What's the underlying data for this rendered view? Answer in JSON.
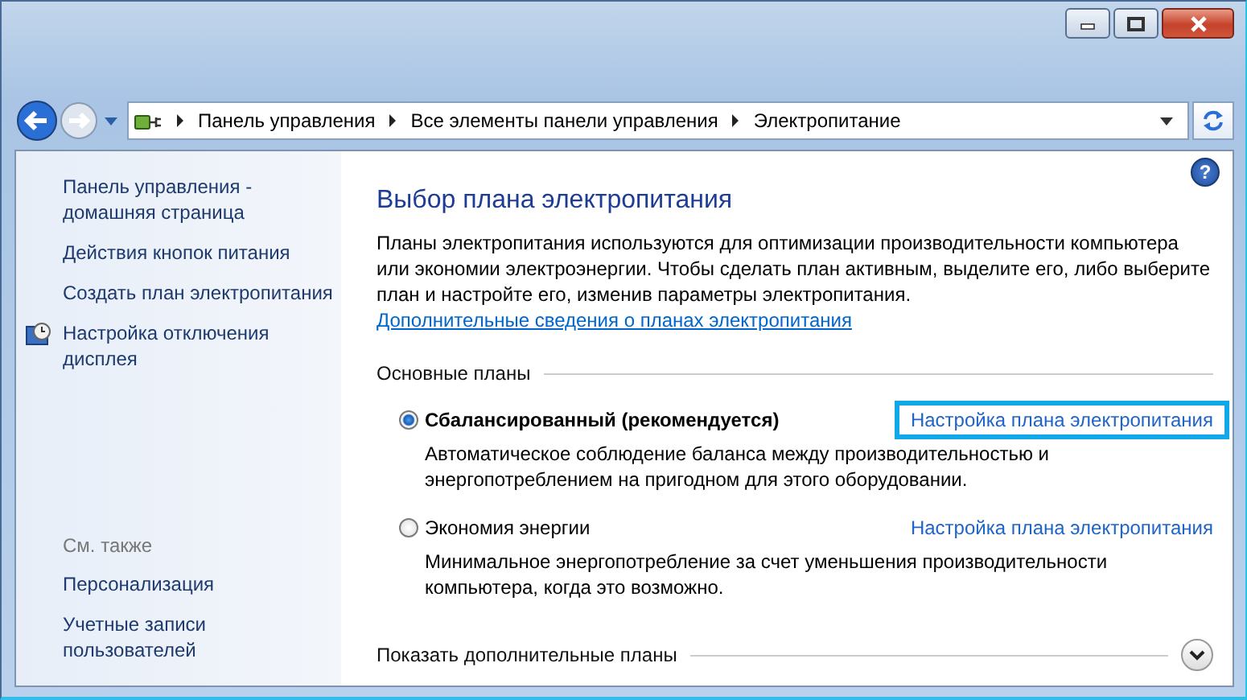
{
  "help_icon": "?",
  "breadcrumbs": [
    "Панель управления",
    "Все элементы панели управления",
    "Электропитание"
  ],
  "sidebar": {
    "items": [
      {
        "label": "Панель управления - домашняя страница",
        "kind": "link"
      },
      {
        "label": "Действия кнопок питания",
        "kind": "link"
      },
      {
        "label": "Создать план электропитания",
        "kind": "link"
      },
      {
        "label": "Настройка отключения дисплея",
        "kind": "icon-link"
      }
    ],
    "see_also": {
      "heading": "См. также",
      "items": [
        "Персонализация",
        "Учетные записи пользователей"
      ]
    }
  },
  "main": {
    "title": "Выбор плана электропитания",
    "intro": "Планы электропитания используются для оптимизации производительности компьютера или экономии электроэнергии. Чтобы сделать план активным, выделите его, либо выберите план и настройте его, изменив параметры электропитания.",
    "intro_link": "Дополнительные сведения о планах электропитания",
    "section": "Основные планы",
    "plans": [
      {
        "name": "Сбалансированный (рекомендуется)",
        "selected": true,
        "description": "Автоматическое соблюдение баланса между производительностью и энергопотреблением на пригодном для этого оборудовании.",
        "link": "Настройка плана электропитания",
        "highlighted": true
      },
      {
        "name": "Экономия энергии",
        "selected": false,
        "description": "Минимальное энергопотребление за счет уменьшения производительности компьютера, когда это возможно.",
        "link": "Настройка плана электропитания",
        "highlighted": false
      }
    ],
    "more": "Показать дополнительные планы"
  }
}
